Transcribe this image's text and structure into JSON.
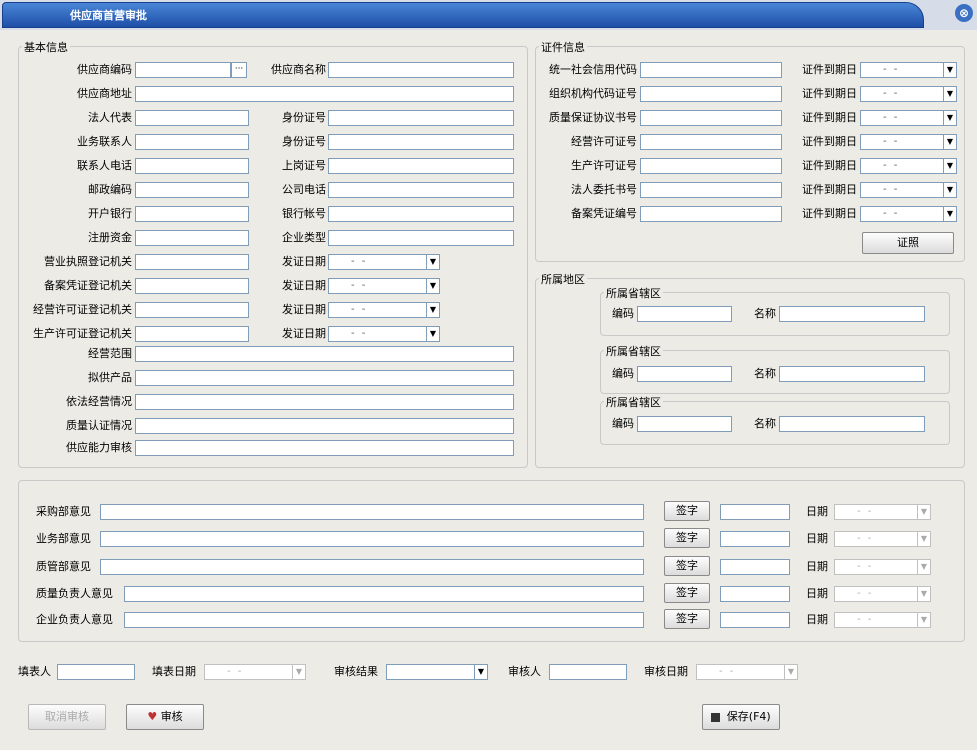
{
  "window": {
    "title": "供应商首营审批",
    "close_icon": "⊗"
  },
  "basic": {
    "section": "基本信息",
    "supplier_code": "供应商编码",
    "supplier_name": "供应商名称",
    "supplier_address": "供应商地址",
    "legal_rep": "法人代表",
    "id_no_1": "身份证号",
    "business_contact": "业务联系人",
    "id_no_2": "身份证号",
    "contact_phone": "联系人电话",
    "work_permit": "上岗证号",
    "postcode": "邮政编码",
    "company_phone": "公司电话",
    "bank": "开户银行",
    "bank_account": "银行帐号",
    "reg_capital": "注册资金",
    "company_type": "企业类型",
    "biz_license_org": "营业执照登记机关",
    "record_cert_org": "备案凭证登记机关",
    "operate_permit_org": "经营许可证登记机关",
    "produce_permit_org": "生产许可证登记机关",
    "issue_date_1": "发证日期",
    "issue_date_2": "发证日期",
    "issue_date_3": "发证日期",
    "issue_date_4": "发证日期",
    "business_scope": "经营范围",
    "proposed_products": "拟供产品",
    "legal_operation": "依法经营情况",
    "quality_cert": "质量认证情况",
    "supply_capacity": "供应能力审核",
    "date_placeholder": "- -",
    "ellipsis": "···"
  },
  "cert": {
    "section": "证件信息",
    "rows": [
      {
        "label": "统一社会信用代码",
        "expire": "证件到期日"
      },
      {
        "label": "组织机构代码证号",
        "expire": "证件到期日"
      },
      {
        "label": "质量保证协议书号",
        "expire": "证件到期日"
      },
      {
        "label": "经营许可证号",
        "expire": "证件到期日"
      },
      {
        "label": "生产许可证号",
        "expire": "证件到期日"
      },
      {
        "label": "法人委托书号",
        "expire": "证件到期日"
      },
      {
        "label": "备案凭证编号",
        "expire": "证件到期日"
      }
    ],
    "photo_button": "证照"
  },
  "region": {
    "section": "所属地区",
    "groups": [
      {
        "title": "所属省辖区",
        "code": "编码",
        "name": "名称"
      },
      {
        "title": "所属省辖区",
        "code": "编码",
        "name": "名称"
      },
      {
        "title": "所属省辖区",
        "code": "编码",
        "name": "名称"
      }
    ]
  },
  "opinions": [
    {
      "label": "采购部意见",
      "sign": "签字",
      "date": "日期"
    },
    {
      "label": "业务部意见",
      "sign": "签字",
      "date": "日期"
    },
    {
      "label": "质管部意见",
      "sign": "签字",
      "date": "日期"
    },
    {
      "label": "质量负责人意见",
      "sign": "签字",
      "date": "日期"
    },
    {
      "label": "企业负责人意见",
      "sign": "签字",
      "date": "日期"
    }
  ],
  "footer": {
    "filler": "填表人",
    "fill_date": "填表日期",
    "review_result": "审核结果",
    "reviewer": "审核人",
    "review_date": "审核日期",
    "cancel_review": "取消审核",
    "review": "审核",
    "save": "保存(F4)"
  },
  "colors": {
    "title_bar": "#1d4fa6",
    "panel": "#ecebe6"
  }
}
